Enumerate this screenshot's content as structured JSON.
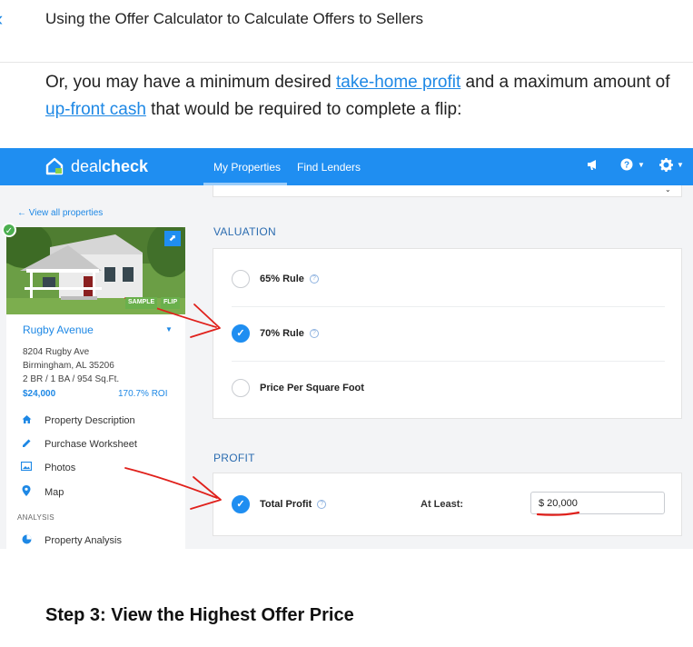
{
  "article": {
    "title": "Using the Offer Calculator to Calculate Offers to Sellers",
    "paragraph": {
      "part1": "Or, you may have a minimum desired ",
      "link1": "take-home profit",
      "part2": " and a maximum amount of ",
      "link2": "up-front cash",
      "part3": " that would be required to complete a flip:"
    },
    "step_heading": "Step 3: View the Highest Offer Price"
  },
  "app": {
    "brand": {
      "light": "deal",
      "bold": "check"
    },
    "nav": [
      "My Properties",
      "Find Lenders"
    ],
    "sidebar": {
      "view_all": "← View all properties",
      "tags": {
        "sample": "SAMPLE",
        "flip": "FLIP"
      },
      "property": {
        "name": "Rugby Avenue",
        "address1": "8204 Rugby Ave",
        "address2": "Birmingham, AL 35206",
        "details": "2 BR  /  1 BA  /  954 Sq.Ft.",
        "price": "$24,000",
        "roi": "170.7% ROI"
      },
      "menu": [
        "Property Description",
        "Purchase Worksheet",
        "Photos",
        "Map"
      ],
      "section_label": "ANALYSIS",
      "analysis_menu": [
        "Property Analysis"
      ]
    },
    "valuation": {
      "label": "VALUATION",
      "options": [
        {
          "label": "65% Rule",
          "selected": false,
          "help": true
        },
        {
          "label": "70% Rule",
          "selected": true,
          "help": true
        },
        {
          "label": "Price Per Square Foot",
          "selected": false,
          "help": false
        }
      ]
    },
    "profit": {
      "label": "PROFIT",
      "option_label": "Total Profit",
      "selected": true,
      "at_least_label": "At Least:",
      "value": "$ 20,000"
    },
    "colors": {
      "brand_blue": "#1f8ef1",
      "link_blue": "#1e88e5",
      "annotation_red": "#e0201b",
      "tag_green": "#6ab04c"
    },
    "icons": [
      "megaphone-icon",
      "help-icon",
      "settings-icon",
      "share-icon",
      "check-icon"
    ]
  }
}
